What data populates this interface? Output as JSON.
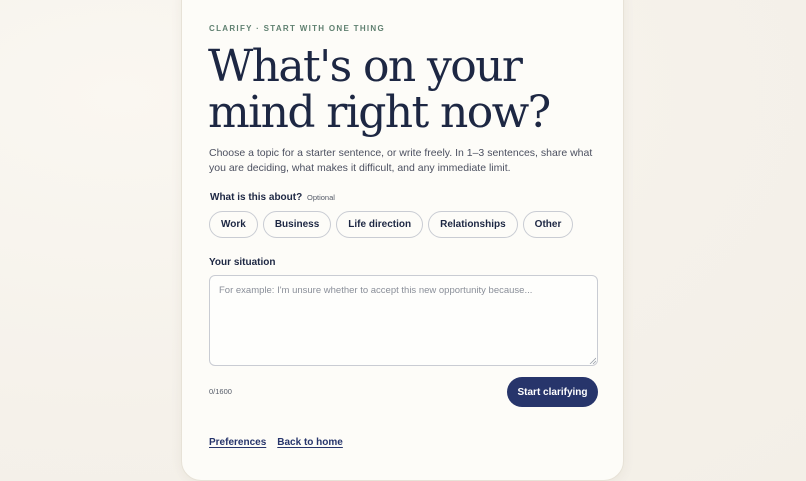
{
  "eyebrow": "CLARIFY · START WITH ONE THING",
  "title": "What's on your mind right now?",
  "description": "Choose a topic for a starter sentence, or write freely. In 1–3 sentences, share what you are deciding, what makes it difficult, and any immediate limit.",
  "topic": {
    "label": "What is this about?",
    "optional": "Optional",
    "chips": [
      "Work",
      "Business",
      "Life direction",
      "Relationships",
      "Other"
    ]
  },
  "situation": {
    "label": "Your situation",
    "placeholder": "For example: I'm unsure whether to accept this new opportunity because...",
    "value": ""
  },
  "counter": "0/1600",
  "primary_button": "Start clarifying",
  "links": {
    "preferences": "Preferences",
    "back_home": "Back to home"
  },
  "colors": {
    "accent": "#27356b",
    "title": "#1d2743",
    "eyebrow": "#5f8070",
    "background": "#f7f4ee",
    "card": "#fdfcf8"
  },
  "icons": {
    "resize_handle": "resize-grip-icon"
  }
}
